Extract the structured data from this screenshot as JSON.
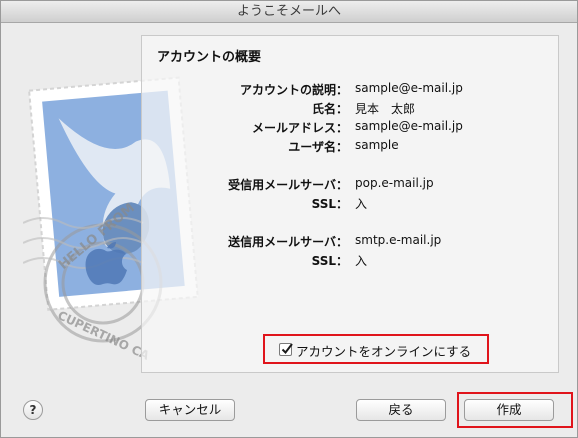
{
  "window": {
    "title": "ようこそメールへ"
  },
  "stamp": {
    "text_top": "HELLO FROM",
    "text_bottom": "CUPERTINO CA"
  },
  "summary": {
    "heading": "アカウントの概要",
    "rows": [
      {
        "label": "アカウントの説明：",
        "value": "sample@e-mail.jp"
      },
      {
        "label": "氏名：",
        "value": "見本　太郎"
      },
      {
        "label": "メールアドレス：",
        "value": "sample@e-mail.jp"
      },
      {
        "label": "ユーザ名：",
        "value": "sample"
      },
      {
        "label": "受信用メールサーバ：",
        "value": "pop.e-mail.jp"
      },
      {
        "label": "SSL：",
        "value": "入"
      },
      {
        "label": "送信用メールサーバ：",
        "value": "smtp.e-mail.jp"
      },
      {
        "label": "SSL：",
        "value": "入"
      }
    ]
  },
  "online_checkbox": {
    "label": "アカウントをオンラインにする",
    "checked": true
  },
  "buttons": {
    "help": "?",
    "cancel": "キャンセル",
    "back": "戻る",
    "create": "作成"
  },
  "colors": {
    "highlight": "#e0141b",
    "stamp_blue": "#7fa4d8"
  }
}
